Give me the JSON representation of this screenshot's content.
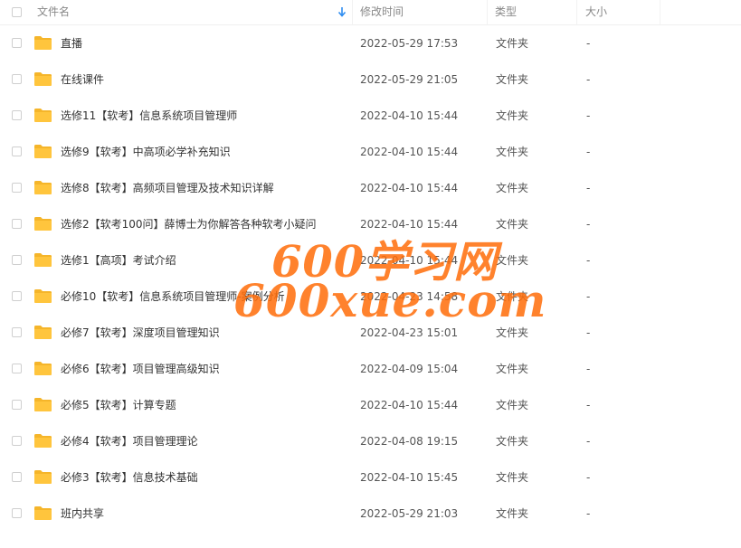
{
  "header": {
    "name_label": "文件名",
    "modified_label": "修改时间",
    "type_label": "类型",
    "size_label": "大小",
    "sort_icon": "arrow-down-icon"
  },
  "rows": [
    {
      "name": "直播",
      "modified": "2022-05-29 17:53",
      "type": "文件夹",
      "size": "-"
    },
    {
      "name": "在线课件",
      "modified": "2022-05-29 21:05",
      "type": "文件夹",
      "size": "-"
    },
    {
      "name": "选修11【软考】信息系统项目管理师",
      "modified": "2022-04-10 15:44",
      "type": "文件夹",
      "size": "-"
    },
    {
      "name": "选修9【软考】中高项必学补充知识",
      "modified": "2022-04-10 15:44",
      "type": "文件夹",
      "size": "-"
    },
    {
      "name": "选修8【软考】高频项目管理及技术知识详解",
      "modified": "2022-04-10 15:44",
      "type": "文件夹",
      "size": "-"
    },
    {
      "name": "选修2【软考100问】薛博士为你解答各种软考小疑问",
      "modified": "2022-04-10 15:44",
      "type": "文件夹",
      "size": "-"
    },
    {
      "name": "选修1【高项】考试介绍",
      "modified": "2022-04-10 15:44",
      "type": "文件夹",
      "size": "-"
    },
    {
      "name": "必修10【软考】信息系统项目管理师-案例分析",
      "modified": "2022-04-23 14:58",
      "type": "文件夹",
      "size": "-"
    },
    {
      "name": "必修7【软考】深度项目管理知识",
      "modified": "2022-04-23 15:01",
      "type": "文件夹",
      "size": "-"
    },
    {
      "name": "必修6【软考】项目管理高级知识",
      "modified": "2022-04-09 15:04",
      "type": "文件夹",
      "size": "-"
    },
    {
      "name": "必修5【软考】计算专题",
      "modified": "2022-04-10 15:44",
      "type": "文件夹",
      "size": "-"
    },
    {
      "name": "必修4【软考】项目管理理论",
      "modified": "2022-04-08 19:15",
      "type": "文件夹",
      "size": "-"
    },
    {
      "name": "必修3【软考】信息技术基础",
      "modified": "2022-04-10 15:45",
      "type": "文件夹",
      "size": "-"
    },
    {
      "name": "班内共享",
      "modified": "2022-05-29 21:03",
      "type": "文件夹",
      "size": "-"
    }
  ],
  "watermark": {
    "line1": "600学习网",
    "line2": "600xue.com"
  },
  "colors": {
    "folder": "#ffc53d",
    "folder_back": "#f5b52a",
    "sort_arrow": "#2d8cf0",
    "watermark": "#ff6e0a"
  }
}
